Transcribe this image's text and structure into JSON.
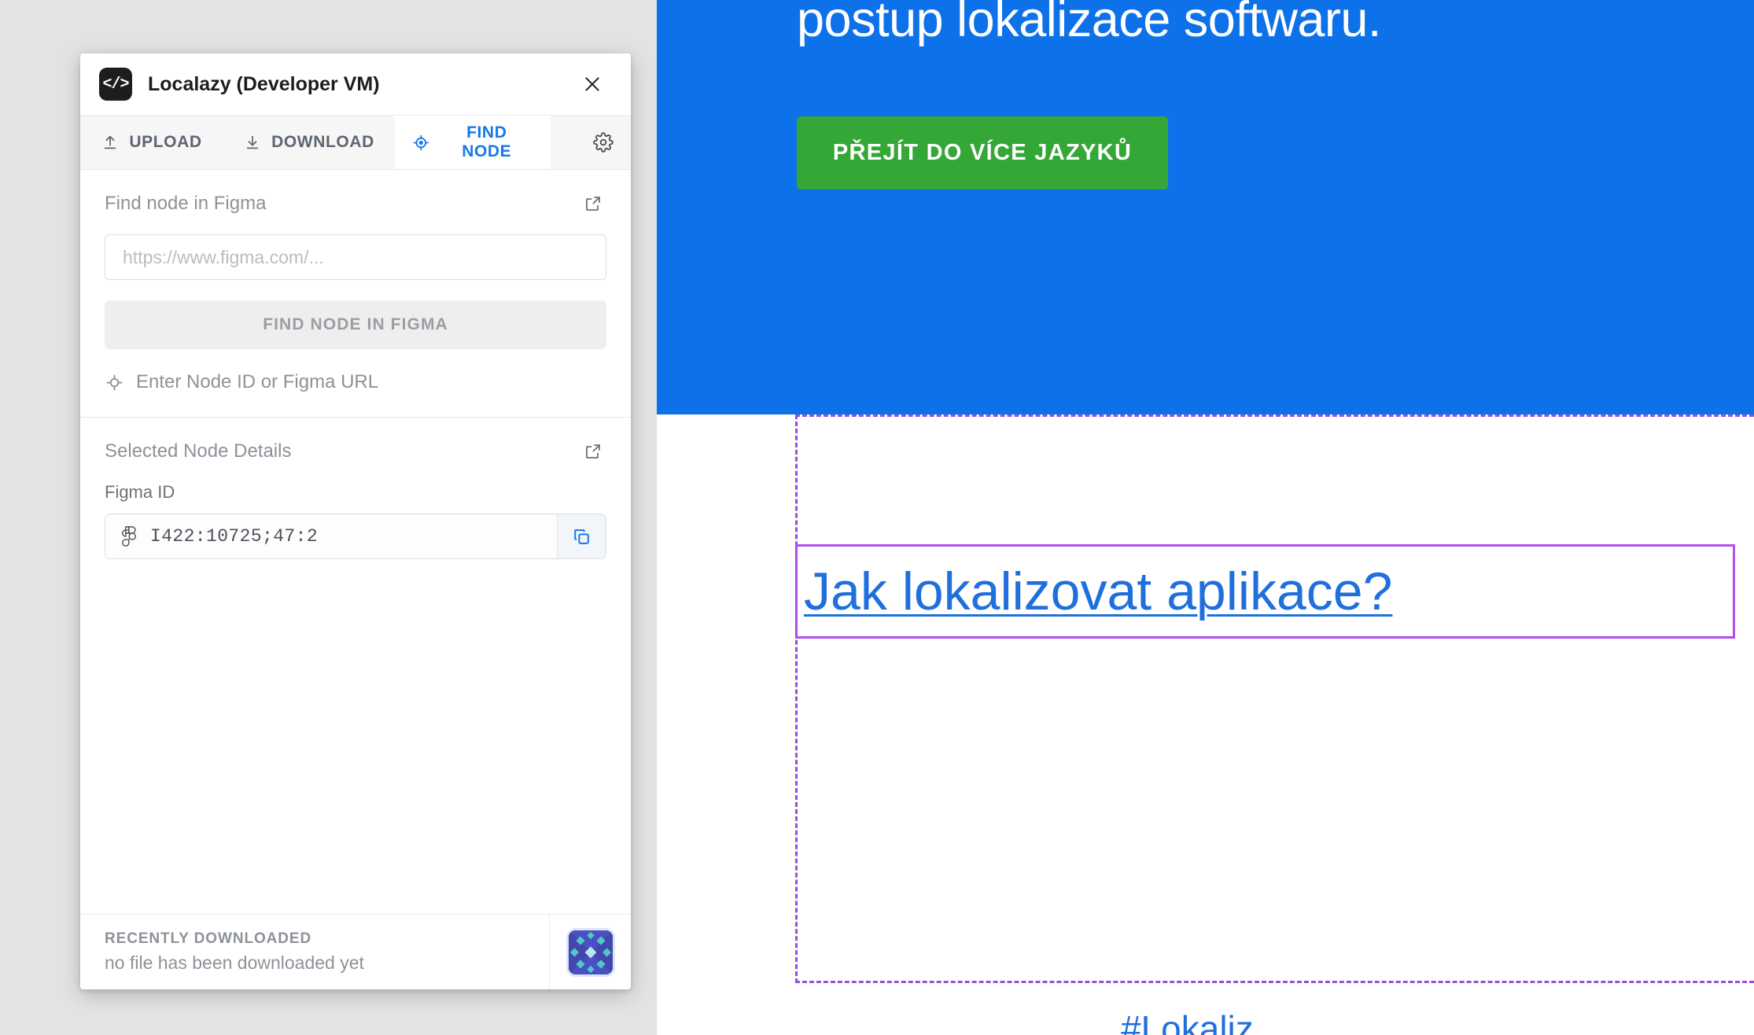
{
  "panel": {
    "title": "Localazy (Developer VM)",
    "logo_glyph": "</>",
    "close_label": "✕",
    "tabs": [
      {
        "id": "upload",
        "label": "UPLOAD",
        "icon": "upload-icon",
        "active": false
      },
      {
        "id": "download",
        "label": "DOWNLOAD",
        "icon": "download-icon",
        "active": false
      },
      {
        "id": "findnode",
        "label": "FIND NODE",
        "icon": "crosshair-icon",
        "active": true
      }
    ],
    "settings_icon": "gear-icon",
    "find_section": {
      "title": "Find node in Figma",
      "external_link_icon": "external-link-icon",
      "input_placeholder": "https://www.figma.com/...",
      "input_value": "",
      "button_label": "FIND NODE IN FIGMA",
      "hint": "Enter Node ID or Figma URL",
      "hint_icon": "crosshair-outline-icon"
    },
    "details_section": {
      "title": "Selected Node Details",
      "external_link_icon": "external-link-icon",
      "field_label": "Figma ID",
      "field_value": "I422:10725;47:2",
      "field_icon": "figma-icon",
      "copy_icon": "copy-icon"
    },
    "footer": {
      "kicker": "RECENTLY DOWNLOADED",
      "status": "no file has been downloaded yet",
      "thumbnail_name": "diamond-pattern-thumbnail"
    }
  },
  "page": {
    "hero": {
      "headline": "postup lokalizace softwaru.",
      "cta_label": "PŘEJÍT DO VÍCE JAZYKŮ",
      "background_color": "#0d71ea",
      "cta_color": "#34a737"
    },
    "selected_heading": "Jak lokalizovat aplikace?",
    "footer_link": "#Lokaliz",
    "link_color": "#1f6fdd",
    "selection_color": "#b24fe8",
    "container_outline_color": "#9b4dd8"
  }
}
